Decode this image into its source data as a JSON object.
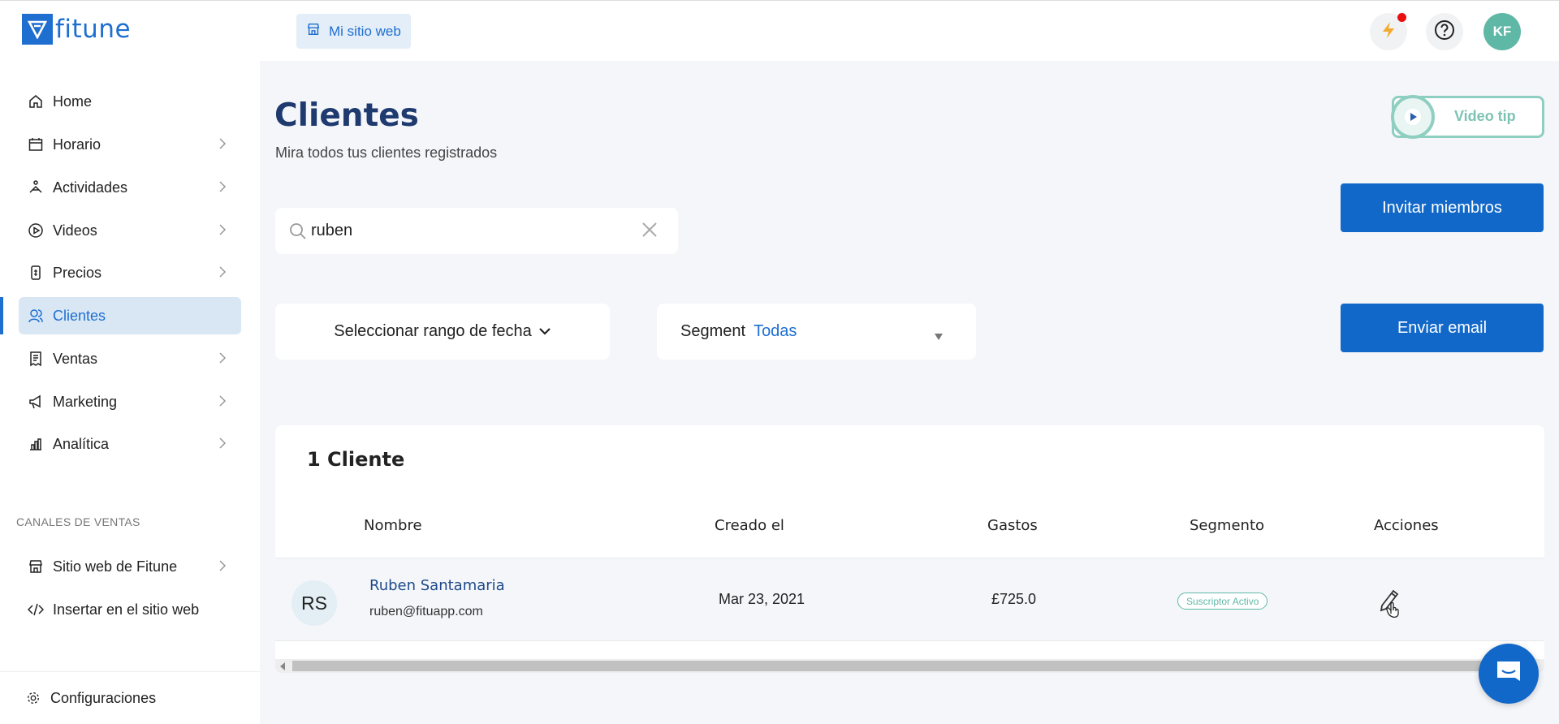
{
  "brand": {
    "name": "fitune",
    "color": "#1e6fd0"
  },
  "header": {
    "site_button": "Mi sitio web",
    "avatar_initials": "KF"
  },
  "sidebar": {
    "items": [
      {
        "label": "Home",
        "icon": "home-icon",
        "has_chevron": false
      },
      {
        "label": "Horario",
        "icon": "calendar-icon",
        "has_chevron": true
      },
      {
        "label": "Actividades",
        "icon": "activity-icon",
        "has_chevron": true
      },
      {
        "label": "Videos",
        "icon": "play-circle-icon",
        "has_chevron": true
      },
      {
        "label": "Precios",
        "icon": "price-tag-icon",
        "has_chevron": true
      },
      {
        "label": "Clientes",
        "icon": "users-icon",
        "has_chevron": false,
        "active": true
      },
      {
        "label": "Ventas",
        "icon": "receipt-icon",
        "has_chevron": true
      },
      {
        "label": "Marketing",
        "icon": "megaphone-icon",
        "has_chevron": true
      },
      {
        "label": "Analítica",
        "icon": "bar-chart-icon",
        "has_chevron": true
      }
    ],
    "section_label": "CANALES DE VENTAS",
    "channels": [
      {
        "label": "Sitio web de Fitune",
        "icon": "store-icon",
        "has_chevron": true
      },
      {
        "label": "Insertar en el sitio web",
        "icon": "code-icon",
        "has_chevron": false
      }
    ],
    "footer": {
      "label": "Configuraciones",
      "icon": "gear-icon"
    }
  },
  "main": {
    "title": "Clientes",
    "subtitle": "Mira todos tus clientes registrados",
    "video_tip": "Video tip",
    "invite_button": "Invitar miembros",
    "email_button": "Enviar email",
    "search": {
      "value": "ruben"
    },
    "date_filter": "Seleccionar rango de fecha",
    "segment_filter": {
      "label": "Segment",
      "value": "Todas"
    }
  },
  "table": {
    "count_label": "1 Cliente",
    "columns": [
      "Nombre",
      "Creado el",
      "Gastos",
      "Segmento",
      "Acciones"
    ],
    "rows": [
      {
        "initials": "RS",
        "name": "Ruben Santamaria",
        "email": "ruben@fituapp.com",
        "created": "Mar 23, 2021",
        "spent": "£725.0",
        "segment": "Suscriptor Activo"
      }
    ]
  },
  "colors": {
    "primary": "#1268c9",
    "teal": "#5fb8a6",
    "notify": "#e81010",
    "title": "#1e3a6e"
  }
}
